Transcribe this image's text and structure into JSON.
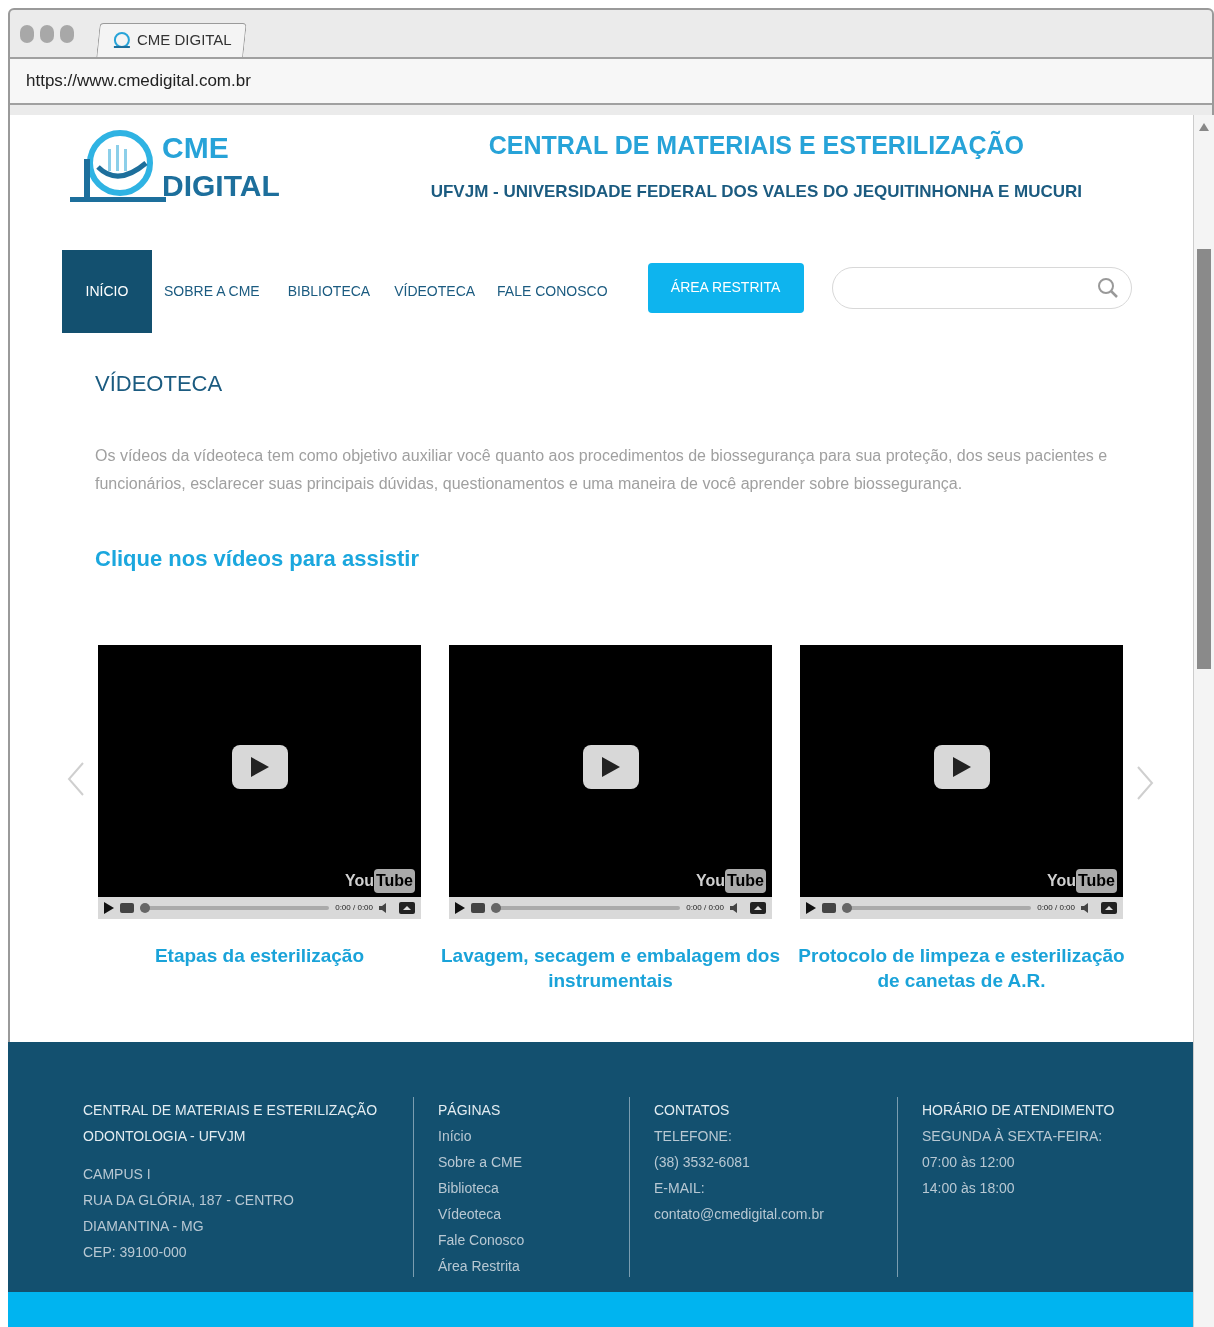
{
  "browser": {
    "tab_title": "CME DIGITAL",
    "url": "https://www.cmedigital.com.br"
  },
  "header": {
    "logo_line_1": "CME",
    "logo_line_2": "DIGITAL",
    "title": "CENTRAL DE MATERIAIS E ESTERILIZAÇÃO",
    "subtitle": "UFVJM - UNIVERSIDADE FEDERAL DOS VALES DO JEQUITINHONHA E MUCURI"
  },
  "nav": {
    "items": [
      {
        "label": "INÍCIO",
        "selected": true
      },
      {
        "label": "SOBRE A CME",
        "selected": false
      },
      {
        "label": "BIBLIOTECA",
        "selected": false
      },
      {
        "label": "VÍDEOTECA",
        "selected": false
      },
      {
        "label": "FALE CONOSCO",
        "selected": false
      }
    ],
    "restricted_button": "ÁREA RESTRITA"
  },
  "page": {
    "heading": "VÍDEOTECA",
    "intro": "Os vídeos da vídeoteca tem como objetivo auxiliar você quanto aos procedimentos de biossegurança para sua proteção, dos seus pacientes e funcionários, esclarecer suas principais dúvidas, questionamentos e uma maneira de você aprender sobre biossegurança.",
    "cta": "Clique nos vídeos para assistir"
  },
  "videos": [
    {
      "logo_you": "You",
      "logo_tube": "Tube",
      "time": "0:00 / 0:00",
      "caption": "Etapas da esterilização"
    },
    {
      "logo_you": "You",
      "logo_tube": "Tube",
      "time": "0:00 / 0:00",
      "caption": "Lavagem, secagem e embalagem dos instrumentais"
    },
    {
      "logo_you": "You",
      "logo_tube": "Tube",
      "time": "0:00 / 0:00",
      "caption": "Protocolo de limpeza e esterilização de canetas de A.R."
    }
  ],
  "footer": {
    "columns": [
      {
        "heading": "CENTRAL DE MATERIAIS E ESTERILIZAÇÃO",
        "lines": [
          {
            "text": "ODONTOLOGIA - UFVJM",
            "kind": "sub"
          },
          {
            "text": "CAMPUS I",
            "kind": "gap"
          },
          {
            "text": "RUA DA GLÓRIA, 187 - CENTRO",
            "kind": "text"
          },
          {
            "text": "DIAMANTINA - MG",
            "kind": "text"
          },
          {
            "text": "CEP: 39100-000",
            "kind": "text"
          }
        ]
      },
      {
        "heading": "PÁGINAS",
        "lines": [
          {
            "text": "Início",
            "kind": "link"
          },
          {
            "text": "Sobre a CME",
            "kind": "link"
          },
          {
            "text": "Biblioteca",
            "kind": "link"
          },
          {
            "text": "Vídeoteca",
            "kind": "link"
          },
          {
            "text": "Fale Conosco",
            "kind": "link"
          },
          {
            "text": "Área Restrita",
            "kind": "link"
          }
        ]
      },
      {
        "heading": "CONTATOS",
        "lines": [
          {
            "text": "TELEFONE:",
            "kind": "text"
          },
          {
            "text": "(38) 3532-6081",
            "kind": "text"
          },
          {
            "text": "E-MAIL:",
            "kind": "text"
          },
          {
            "text": "contato@cmedigital.com.br",
            "kind": "link"
          }
        ]
      },
      {
        "heading": "HORÁRIO DE ATENDIMENTO",
        "lines": [
          {
            "text": "SEGUNDA À SEXTA-FEIRA:",
            "kind": "text"
          },
          {
            "text": "07:00 às 12:00",
            "kind": "text"
          },
          {
            "text": "14:00 às 18:00",
            "kind": "text"
          }
        ]
      }
    ]
  }
}
